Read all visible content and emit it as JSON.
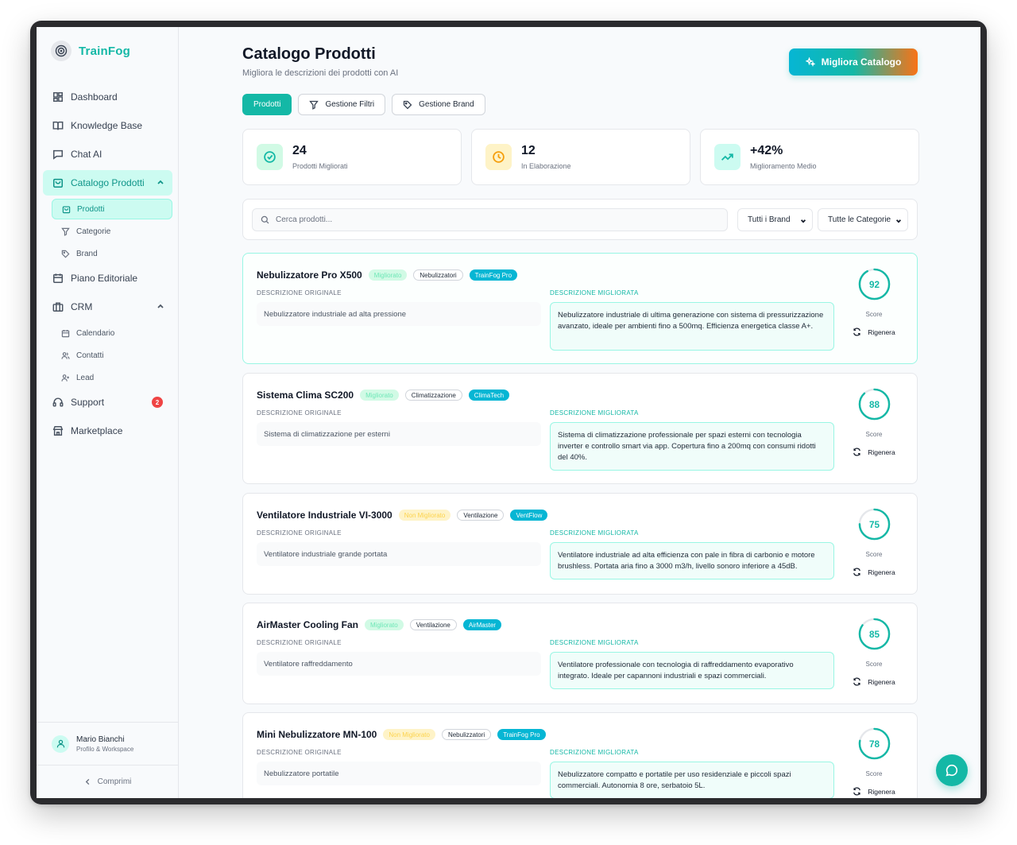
{
  "app": {
    "name": "TrainFog"
  },
  "sidebar": {
    "items": [
      {
        "label": "Dashboard",
        "icon": "dashboard-icon"
      },
      {
        "label": "Knowledge Base",
        "icon": "book-icon"
      },
      {
        "label": "Chat AI",
        "icon": "chat-icon"
      },
      {
        "label": "Catalogo Prodotti",
        "icon": "bag-icon",
        "active": true
      },
      {
        "label": "Piano Editoriale",
        "icon": "calendar-icon"
      },
      {
        "label": "CRM",
        "icon": "briefcase-icon"
      },
      {
        "label": "Support",
        "icon": "headset-icon",
        "badge": "2"
      },
      {
        "label": "Marketplace",
        "icon": "store-icon"
      }
    ],
    "catalog_sub": [
      {
        "label": "Prodotti",
        "active": true
      },
      {
        "label": "Categorie"
      },
      {
        "label": "Brand"
      }
    ],
    "crm_sub": [
      {
        "label": "Calendario"
      },
      {
        "label": "Contatti"
      },
      {
        "label": "Lead"
      }
    ],
    "profile": {
      "name": "Mario Bianchi",
      "role": "Profilo & Workspace"
    },
    "collapse_label": "Comprimi"
  },
  "header": {
    "title": "Catalogo Prodotti",
    "subtitle": "Migliora le descrizioni dei prodotti con AI",
    "cta_label": "Migliora Catalogo"
  },
  "tabs": [
    {
      "label": "Prodotti",
      "active": true
    },
    {
      "label": "Gestione Filtri",
      "icon": "filter-icon"
    },
    {
      "label": "Gestione Brand",
      "icon": "tag-icon"
    }
  ],
  "stats": [
    {
      "value": "24",
      "label": "Prodotti Migliorati",
      "color": "#14b8a6",
      "bg": "#d1fae5"
    },
    {
      "value": "12",
      "label": "In Elaborazione",
      "color": "#f59e0b",
      "bg": "#fef3c7"
    },
    {
      "value": "+42%",
      "label": "Miglioramento Medio",
      "color": "#14b8a6",
      "bg": "#ccfbf1"
    }
  ],
  "filters": {
    "search_placeholder": "Cerca prodotti...",
    "brand_select": "Tutti i Brand",
    "category_select": "Tutte le Categorie"
  },
  "labels": {
    "original": "DESCRIZIONE ORIGINALE",
    "improved": "DESCRIZIONE MIGLIORATA",
    "score": "Score",
    "regen": "Rigenera"
  },
  "products": [
    {
      "name": "Nebulizzatore Pro X500",
      "status": "Migliorato",
      "status_type": "ok",
      "category": "Nebulizzatori",
      "brand": "TrainFog Pro",
      "original": "Nebulizzatore industriale ad alta pressione",
      "improved": "Nebulizzatore industriale di ultima generazione con sistema di pressurizzazione avanzato, ideale per ambienti fino a 500mq. Efficienza energetica classe A+.",
      "score": 92
    },
    {
      "name": "Sistema Clima SC200",
      "status": "Migliorato",
      "status_type": "ok",
      "category": "Climatizzazione",
      "brand": "ClimaTech",
      "original": "Sistema di climatizzazione per esterni",
      "improved": "Sistema di climatizzazione professionale per spazi esterni con tecnologia inverter e controllo smart via app. Copertura fino a 200mq con consumi ridotti del 40%.",
      "score": 88
    },
    {
      "name": "Ventilatore Industriale VI-3000",
      "status": "Non Migliorato",
      "status_type": "no",
      "category": "Ventilazione",
      "brand": "VentFlow",
      "original": "Ventilatore industriale grande portata",
      "improved": "Ventilatore industriale ad alta efficienza con pale in fibra di carbonio e motore brushless. Portata aria fino a 3000 m3/h, livello sonoro inferiore a 45dB.",
      "score": 75
    },
    {
      "name": "AirMaster Cooling Fan",
      "status": "Migliorato",
      "status_type": "ok",
      "category": "Ventilazione",
      "brand": "AirMaster",
      "original": "Ventilatore raffreddamento",
      "improved": "Ventilatore professionale con tecnologia di raffreddamento evaporativo integrato. Ideale per capannoni industriali e spazi commerciali.",
      "score": 85
    },
    {
      "name": "Mini Nebulizzatore MN-100",
      "status": "Non Migliorato",
      "status_type": "no",
      "category": "Nebulizzatori",
      "brand": "TrainFog Pro",
      "original": "Nebulizzatore portatile",
      "improved": "Nebulizzatore compatto e portatile per uso residenziale e piccoli spazi commerciali. Autonomia 8 ore, serbatoio 5L.",
      "score": 78
    }
  ]
}
